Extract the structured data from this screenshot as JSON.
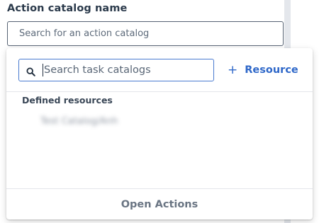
{
  "field": {
    "label": "Action catalog name",
    "placeholder": "Search for an action catalog"
  },
  "popover": {
    "search": {
      "placeholder": "Search task catalogs",
      "icon": "search-icon"
    },
    "add_resource": {
      "icon": "plus-icon",
      "icon_glyph": "+",
      "label": "Resource"
    },
    "section_label": "Defined resources",
    "items": [
      {
        "label": "Test Catalog/Anh"
      }
    ],
    "footer_label": "Open Actions"
  },
  "colors": {
    "accent": "#2f68c9",
    "focus_border": "#4a7bd0",
    "input_border": "#566273",
    "divider": "#e3e6ea"
  }
}
